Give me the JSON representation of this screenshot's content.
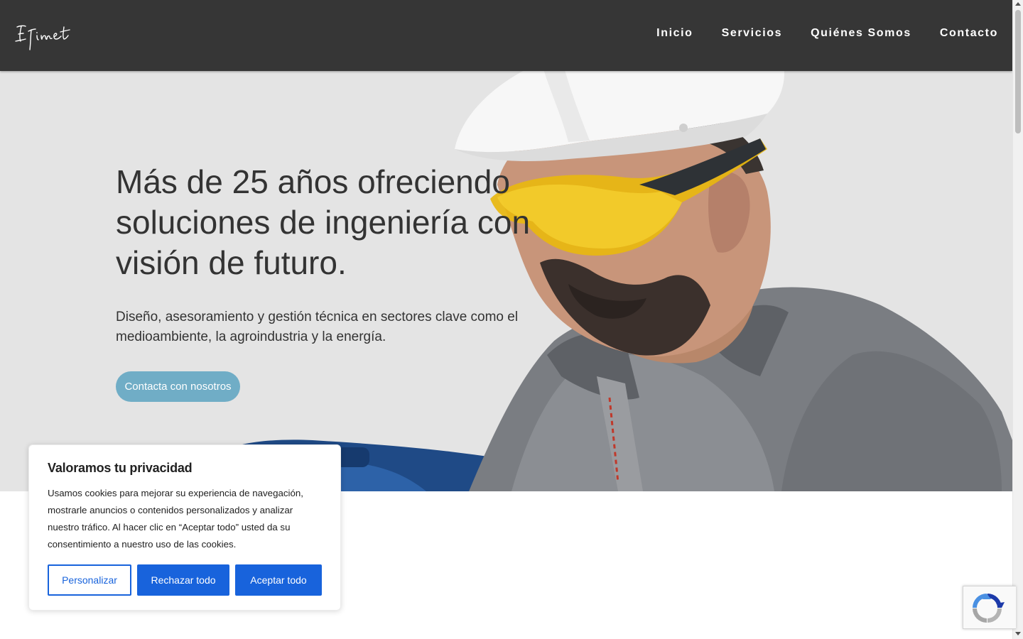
{
  "header": {
    "logo_text": "Efimet",
    "nav": [
      {
        "label": "Inicio"
      },
      {
        "label": "Servicios"
      },
      {
        "label": "Quiénes Somos"
      },
      {
        "label": "Contacto"
      }
    ]
  },
  "hero": {
    "title": "Más de 25 años ofreciendo soluciones de ingeniería con visión de futuro.",
    "subtitle": "Diseño, asesoramiento y gestión técnica en sectores clave como el medioambiente, la agroindustria y la energía.",
    "cta_label": "Contacta con nosotros"
  },
  "cookie_banner": {
    "title": "Valoramos tu privacidad",
    "text": "Usamos cookies para mejorar su experiencia de navegación, mostrarle anuncios o contenidos personalizados y analizar nuestro tráfico. Al hacer clic en “Aceptar todo” usted da su consentimiento a nuestro uso de las cookies.",
    "customize_label": "Personalizar",
    "reject_label": "Rechazar todo",
    "accept_label": "Aceptar todo"
  },
  "colors": {
    "header_bg": "#363636",
    "hero_bg": "#e4e4e4",
    "cta_bg": "#70adc6",
    "cookie_accent": "#1863dc"
  },
  "icons": {
    "logo": "efimet-signature-logo",
    "recaptcha": "recaptcha-logo-icon"
  }
}
